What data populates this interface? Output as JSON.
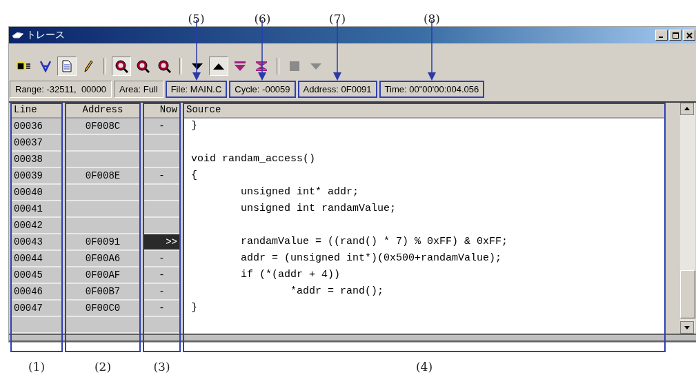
{
  "window": {
    "title": "トレース"
  },
  "toolbar": [
    {
      "buttons": [
        {
          "kind": "chip",
          "pressed": false,
          "disabled": false
        },
        {
          "kind": "filter",
          "pressed": false,
          "disabled": false
        },
        {
          "kind": "document",
          "pressed": true,
          "disabled": false
        },
        {
          "kind": "pencil",
          "pressed": false,
          "disabled": false
        }
      ]
    },
    {
      "buttons": [
        {
          "kind": "zoom",
          "pressed": true,
          "disabled": false
        },
        {
          "kind": "zoom",
          "pressed": false,
          "disabled": false
        },
        {
          "kind": "zoom",
          "pressed": false,
          "disabled": false
        }
      ]
    },
    {
      "buttons": [
        {
          "kind": "down",
          "pressed": false,
          "disabled": false
        },
        {
          "kind": "up",
          "pressed": true,
          "disabled": false
        },
        {
          "kind": "bar-down",
          "pressed": false,
          "disabled": false
        },
        {
          "kind": "bar-both",
          "pressed": false,
          "disabled": false
        }
      ]
    },
    {
      "buttons": [
        {
          "kind": "square",
          "pressed": false,
          "disabled": true
        },
        {
          "kind": "down",
          "pressed": false,
          "disabled": true
        }
      ]
    }
  ],
  "status_fields": [
    {
      "text": "Range: -32511,  00000"
    },
    {
      "text": "Area: Full"
    },
    {
      "text": "File: MAIN.C",
      "callout": "(5)"
    },
    {
      "text": "Cycle: -00059",
      "callout": "(6)"
    },
    {
      "text": "Address: 0F0091",
      "callout": "(7)"
    },
    {
      "text": "Time: 00\"00'00:004.056",
      "callout": "(8)"
    }
  ],
  "columns": [
    {
      "kind": "line",
      "header": "Line",
      "callout": "(1)"
    },
    {
      "kind": "address",
      "header": "Address",
      "callout": "(2)"
    },
    {
      "kind": "now",
      "header": "Now",
      "callout": "(3)"
    },
    {
      "kind": "source",
      "header": "Source",
      "callout": "(4)"
    }
  ],
  "rows": [
    {
      "line": "00036",
      "address": "0F008C",
      "now": "-",
      "current": false,
      "source": "}"
    },
    {
      "line": "00037",
      "current": false
    },
    {
      "line": "00038",
      "current": false,
      "source": "void randam_access()"
    },
    {
      "line": "00039",
      "address": "0F008E",
      "now": "-",
      "current": false,
      "source": "{"
    },
    {
      "line": "00040",
      "current": false,
      "source": "        unsigned int* addr;"
    },
    {
      "line": "00041",
      "current": false,
      "source": "        unsigned int randamValue;"
    },
    {
      "line": "00042",
      "current": false
    },
    {
      "line": "00043",
      "address": "0F0091",
      "now": ">>",
      "current": true,
      "source": "        randamValue = ((rand() * 7) % 0xFF) & 0xFF;"
    },
    {
      "line": "00044",
      "address": "0F00A6",
      "now": "-",
      "current": false,
      "source": "        addr = (unsigned int*)(0x500+randamValue);"
    },
    {
      "line": "00045",
      "address": "0F00AF",
      "now": "-",
      "current": false,
      "source": "        if (*(addr + 4))"
    },
    {
      "line": "00046",
      "address": "0F00B7",
      "now": "-",
      "current": false,
      "source": "                *addr = rand();"
    },
    {
      "line": "00047",
      "address": "0F00C0",
      "now": "-",
      "current": false,
      "source": "}"
    }
  ]
}
